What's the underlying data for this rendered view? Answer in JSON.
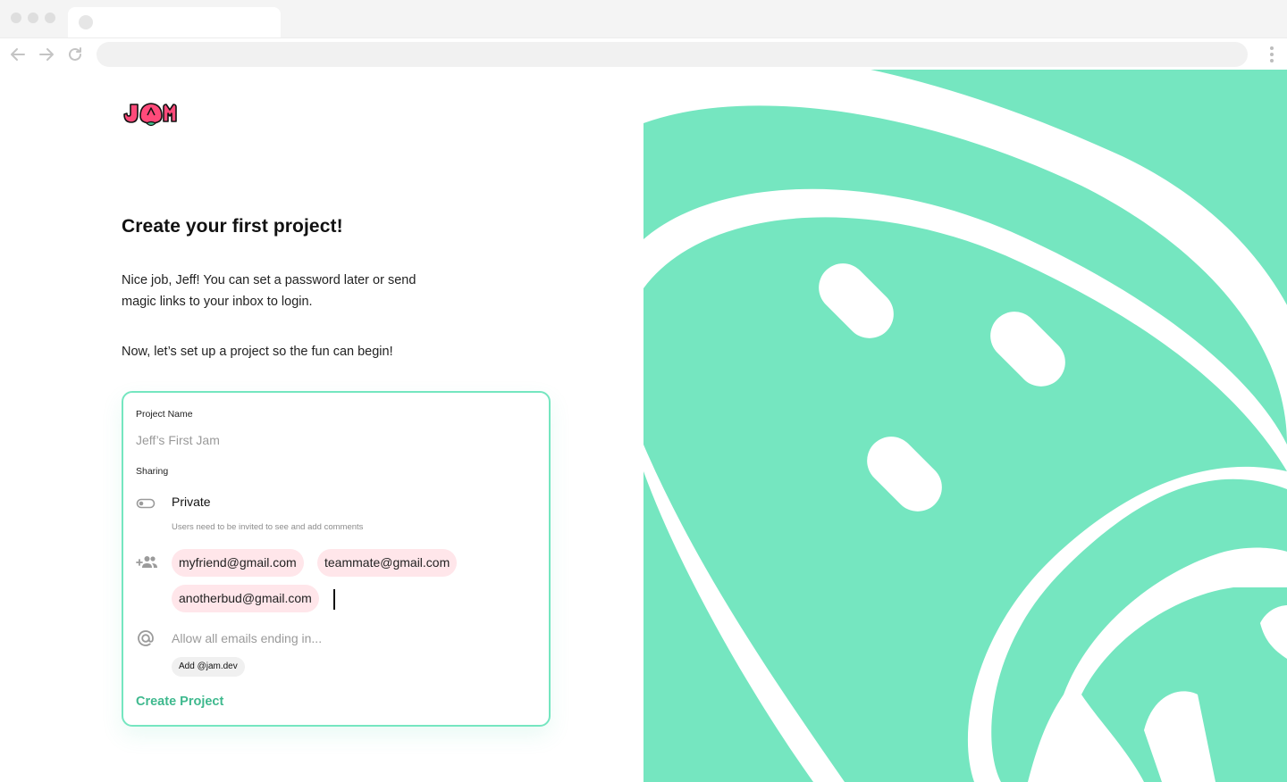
{
  "brand": {
    "logo_text": "JAM",
    "accent": "#75e6c0",
    "logo_color": "#ff4a7a",
    "action_color": "#3fb98e"
  },
  "page": {
    "title": "Create your first project!",
    "intro_line1": "Nice job, Jeff! You can set a password later or send magic links to your inbox to login.",
    "intro_line2": "Now, let’s set up a project so the fun can begin!"
  },
  "form": {
    "project_name_label": "Project Name",
    "project_name_placeholder": "Jeff’s First Jam",
    "sharing_label": "Sharing",
    "privacy_option": "Private",
    "privacy_help": "Users need to be invited to see and add comments",
    "invitees": [
      "myfriend@gmail.com",
      "teammate@gmail.com",
      "anotherbud@gmail.com"
    ],
    "domain_placeholder": "Allow all emails ending in...",
    "domain_suggestion": "Add @jam.dev",
    "submit_label": "Create Project"
  },
  "icons": {
    "privacy": "toggle-icon",
    "invite": "add-people-icon",
    "domain": "at-sign-icon"
  }
}
